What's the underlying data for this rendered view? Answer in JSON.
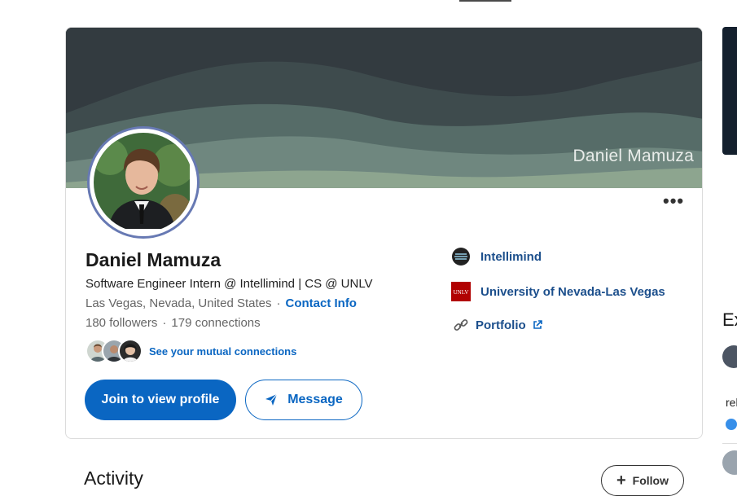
{
  "banner": {
    "name_text": "Daniel Mamuza"
  },
  "profile": {
    "name": "Daniel Mamuza",
    "headline": "Software Engineer Intern @ Intellimind | CS @ UNLV",
    "location": "Las Vegas, Nevada, United States",
    "contact_info_label": "Contact Info",
    "followers": "180 followers",
    "connections": "179 connections",
    "mutual_label": "See your mutual connections",
    "more_label": "•••"
  },
  "actions": {
    "join_label": "Join to view profile",
    "message_label": "Message"
  },
  "right_info": {
    "company": "Intellimind",
    "school": "University of Nevada-Las Vegas",
    "portfolio": "Portfolio"
  },
  "activity": {
    "title": "Activity",
    "follow_label": "Follow"
  },
  "sidebar": {
    "heading_fragment": "Ex",
    "text_fragment": "rel"
  },
  "colors": {
    "accent": "#0a66c2",
    "banner_dark": "#323a3f",
    "link_dark": "#1c4f8c",
    "avatar_ring": "#6779b3"
  },
  "icons": {
    "company": "intellimind-logo",
    "school": "unlv-logo",
    "portfolio": "link-icon",
    "external": "external-link-icon",
    "message": "send-icon",
    "follow": "plus-icon",
    "more": "more-horizontal-icon"
  }
}
